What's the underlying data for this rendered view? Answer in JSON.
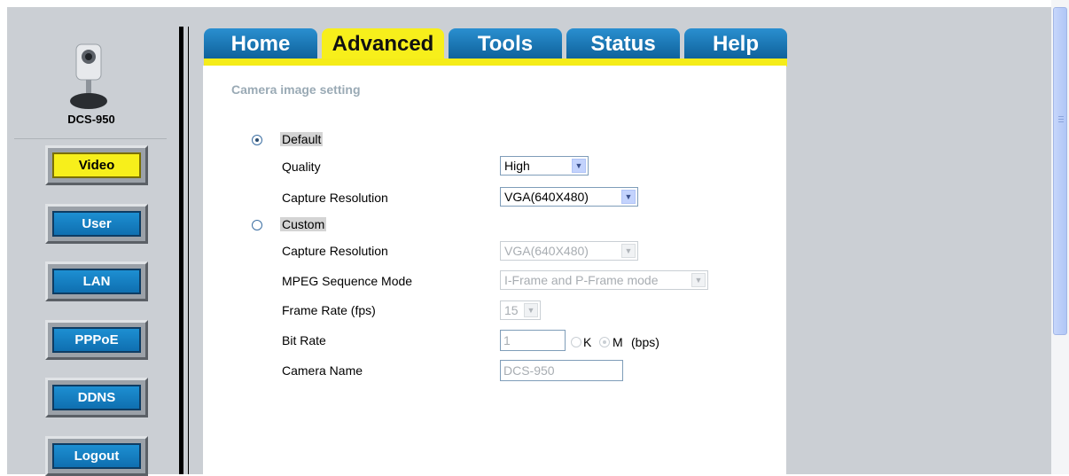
{
  "device": {
    "model": "DCS-950"
  },
  "sidebar": {
    "items": [
      {
        "label": "Video",
        "active": true
      },
      {
        "label": "User",
        "active": false
      },
      {
        "label": "LAN",
        "active": false
      },
      {
        "label": "PPPoE",
        "active": false
      },
      {
        "label": "DDNS",
        "active": false
      },
      {
        "label": "Logout",
        "active": false
      }
    ]
  },
  "tabs": [
    {
      "label": "Home",
      "active": false
    },
    {
      "label": "Advanced",
      "active": true
    },
    {
      "label": "Tools",
      "active": false
    },
    {
      "label": "Status",
      "active": false
    },
    {
      "label": "Help",
      "active": false
    }
  ],
  "main": {
    "section_title": "Camera image setting",
    "default_option": {
      "label": "Default",
      "selected": true,
      "quality_label": "Quality",
      "quality_value": "High",
      "resolution_label": "Capture Resolution",
      "resolution_value": "VGA(640X480)"
    },
    "custom_option": {
      "label": "Custom",
      "selected": false,
      "resolution_label": "Capture Resolution",
      "resolution_value": "VGA(640X480)",
      "mpeg_label": "MPEG Sequence Mode",
      "mpeg_value": "I-Frame and P-Frame mode",
      "framerate_label": "Frame Rate (fps)",
      "framerate_value": "15",
      "bitrate_label": "Bit Rate",
      "bitrate_value": "1",
      "bitrate_unit_k": "K",
      "bitrate_unit_m": "M",
      "bitrate_suffix": "(bps)",
      "camera_name_label": "Camera Name",
      "camera_name_value": "DCS-950"
    }
  },
  "colors": {
    "tab_blue": "#1a7fc4",
    "tab_active_yellow": "#f7ef1b",
    "background_gray": "#cbcfd4"
  }
}
